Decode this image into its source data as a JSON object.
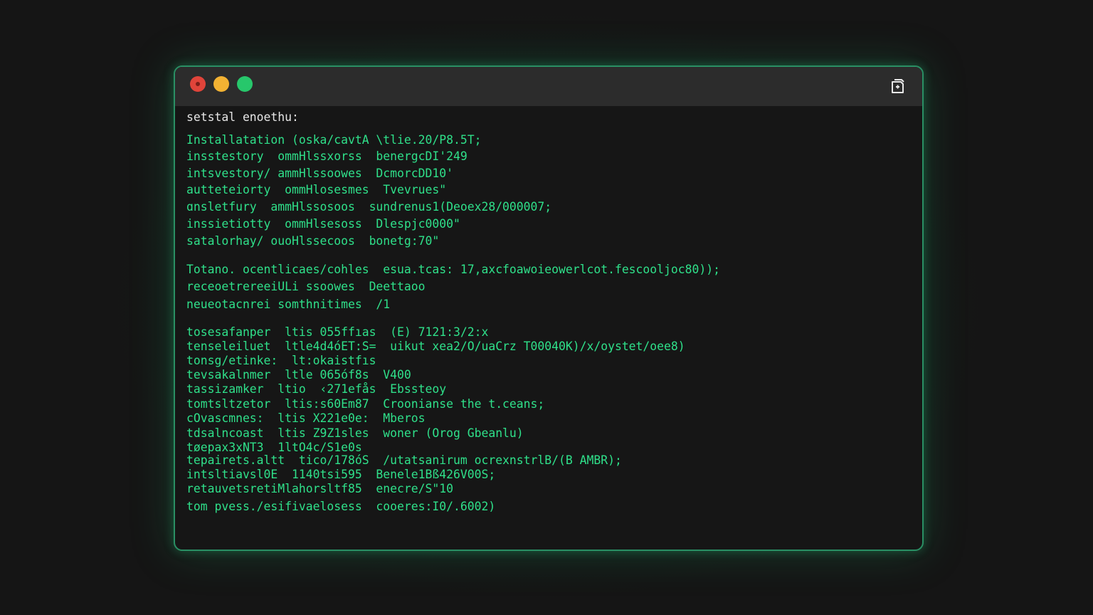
{
  "window": {
    "header": "setstal enoethu:",
    "buttons": {
      "close": "close",
      "minimize": "minimize",
      "maximize": "maximize"
    },
    "titlebar_icon": "new-tab-icon"
  },
  "terminal": {
    "lines": [
      "Installatation (oska/cavtA \\tlie.20/P8.5T;",
      "insstestory  ommHlssxorss  benergcDI'249",
      "intsvestory/ ammHlssoowes  DcmorcDD10'",
      "autteteiorty  ommHlosesmes  Tvevrues\"",
      "ɑnsletfury  ammHlssosoos  sundrenus1(Deoex28/000007;",
      "inssietiotty  ommHlsesoss  Dlespjc0000\"",
      "satalorhay/ ouoHlssecoos  bonetg:70\"",
      "Totano. ocentlicaes/cohles  esua.tcas: 17,axcfoawoieowerlcot.fescooljoc80));",
      "receoetrereeiULi ssoowes  Deettaoo",
      "neueotacnrei somthnitimes  /1",
      "tosesafanper  ltis 055ffıas  (E) 7121:3/2:x",
      "tenseleiluet  ltle4d4óET:S=  uikut xea2/O/uaCrz T00040K)/x/oystet/oee8)",
      "tonsg/etinke:  lt:okaistfıs",
      "tevsakalnmer  ltle 065óf8s  V400",
      "tassizamker  ltio  ‹271efås  Ebssteoy",
      "tomtsltzetor  ltis:s60Em87  Croonianse the t.ceans;",
      "cOvascmnes:  ltis X221e0e:  Mberos",
      "tdsalncoast  ltis Z9Z1sles  woner (Orog Gbeanlu)",
      "tøepax3xNT3  1ltO4c/S1e0s",
      "tepairets.altt  tico/178óS  /utatsanirum ocrexnstrlB/(B AMBR);",
      "intsltiavsl0E  1140tsi595  Benele1Bß426V00S;",
      "retauvetsretiMlahorsltf85  enecre/S\"10",
      "tom pvess./esifivaelosess  cooeres:I0/.6002)"
    ]
  }
}
